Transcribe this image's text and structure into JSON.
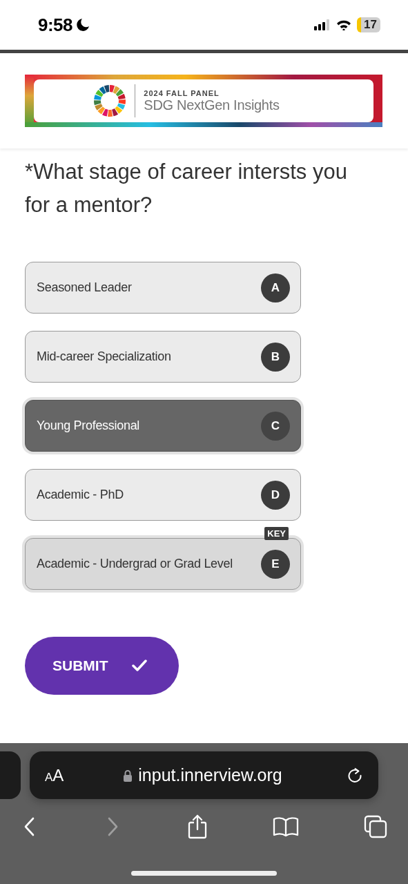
{
  "status_bar": {
    "time": "9:58",
    "battery": "17"
  },
  "banner": {
    "kicker": "2024 FALL PANEL",
    "title": "SDG NextGen Insights"
  },
  "question": "*What stage of career intersts you for a mentor?",
  "options": [
    {
      "label": "Seasoned Leader",
      "key": "A",
      "selected": false,
      "focused": false
    },
    {
      "label": "Mid-career Specialization",
      "key": "B",
      "selected": false,
      "focused": false
    },
    {
      "label": "Young Professional",
      "key": "C",
      "selected": true,
      "focused": false
    },
    {
      "label": "Academic - PhD",
      "key": "D",
      "selected": false,
      "focused": false
    },
    {
      "label": "Academic - Undergrad or Grad Level",
      "key": "E",
      "selected": false,
      "focused": true,
      "badge": "KEY"
    }
  ],
  "submit": {
    "label": "SUBMIT"
  },
  "browser": {
    "text_size": "AA",
    "url": "input.innerview.org",
    "forward_disabled": true
  }
}
